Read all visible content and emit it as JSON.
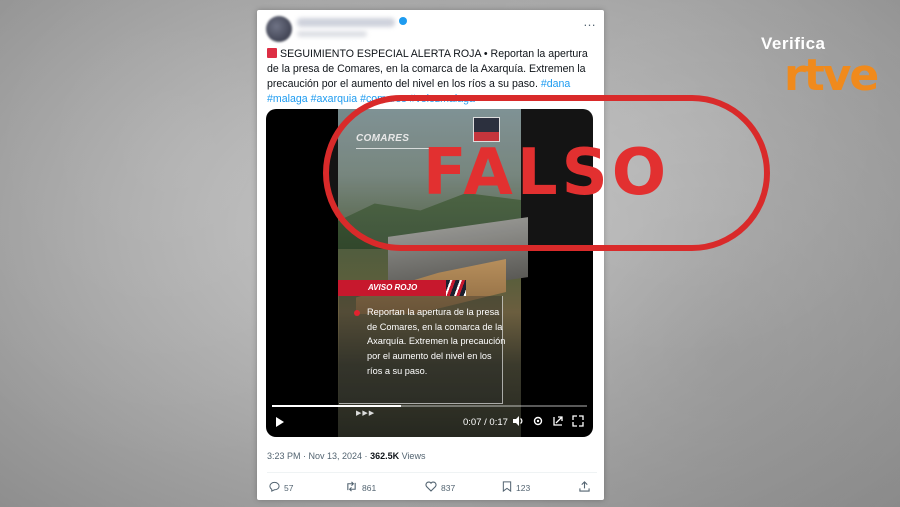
{
  "brand": {
    "verifica": "Verifica",
    "rtve": "rtve"
  },
  "tweet": {
    "prefix": "SEGUIMIENTO ESPECIAL ALERTA ROJA • Reportan la apertura de la presa de Comares, en la comarca de la Axarquía. Extremen la precaución por el aumento del nivel en los ríos a su paso.",
    "hashtags": [
      "#dana",
      "#malaga",
      "#axarquia",
      "#comares",
      "#velezmalaga"
    ],
    "more_icon": "…"
  },
  "video": {
    "tag": "COMARES",
    "alert_label": "AVISO ROJO",
    "alert_text": "Reportan la apertura de la presa de Comares, en la comarca de la Axarquía. Extremen la precaución por el aumento del nivel en los ríos a su paso.",
    "arrows": "▶▶▶",
    "time": "0:07 / 0:17",
    "progress": 0.41
  },
  "stamp": {
    "text": "FALSO",
    "color": "#d92a2a"
  },
  "meta": {
    "time": "3:23 PM · Nov 13, 2024 · ",
    "views_count": "362.5K",
    "views_label": " Views"
  },
  "actions": {
    "replies": "57",
    "reposts": "861",
    "likes": "837",
    "bookmarks": "123"
  },
  "icons": [
    "reply-icon",
    "repost-icon",
    "like-icon",
    "bookmark-icon",
    "share-icon",
    "play-icon",
    "volume-icon",
    "settings-icon",
    "fullscreen-icon",
    "more-icon"
  ]
}
